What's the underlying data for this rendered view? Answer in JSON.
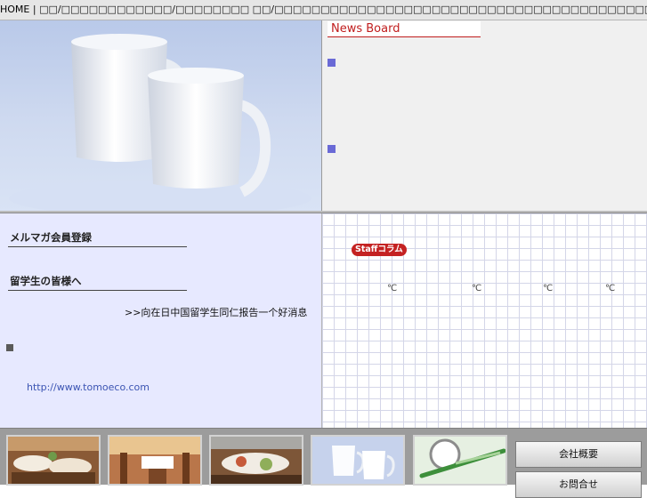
{
  "nav": {
    "home": "HOME",
    "separator": "|",
    "rest": "□□/□□□□□□□□□□□□/□□□□□□□□ □□/□□□□□□□□□□□□□□□□□□□□□□□□□□□□□□□□□□□□□□□□□□□□□□□"
  },
  "news": {
    "title": "News Board"
  },
  "left": {
    "mailmag": "メルマガ会員登録",
    "students": "留学生の皆様へ",
    "report_link": ">>向在日中国留学生同仁报告一个好消息",
    "url": "http://www.tomoeco.com"
  },
  "column": {
    "badge": "Staffコラム",
    "temps": [
      "℃",
      "℃",
      "℃",
      "℃"
    ]
  },
  "footer": {
    "thumbnails": [
      {
        "name": "restaurant-photo-1"
      },
      {
        "name": "restaurant-photo-2"
      },
      {
        "name": "restaurant-photo-3"
      },
      {
        "name": "mugs-photo"
      },
      {
        "name": "toothbrush-photo"
      }
    ],
    "company_button": "会社概要",
    "second_button": "お問合せ"
  },
  "colors": {
    "news_title": "#c01d1d",
    "bullet": "#6a6ad6",
    "link": "#3b54b3",
    "badge": "#c42222"
  }
}
